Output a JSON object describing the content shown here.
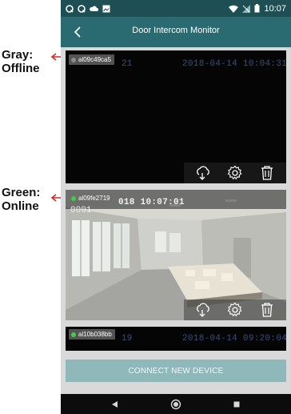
{
  "status_bar": {
    "time": "10:07",
    "icons": [
      "notification-icon",
      "notification-icon",
      "cloud-icon",
      "image-icon",
      "wifi-icon",
      "signal-icon",
      "battery-icon"
    ]
  },
  "app_bar": {
    "title": "Door Intercom Monitor"
  },
  "annotations": {
    "gray": {
      "line1": "Gray:",
      "line2": "Offline"
    },
    "green": {
      "line1": "Green:",
      "line2": "Online"
    },
    "arrow_color": "#d12a2a"
  },
  "devices": [
    {
      "id": "al09c49ca5",
      "status": "offline",
      "status_color": "#8a8a8a",
      "osd_time": "2018-04-14 10:04:31",
      "osd_num": "21"
    },
    {
      "id": "al09fe2719",
      "status": "online",
      "status_color": "#3fcf3f",
      "osd_time": "018 10:07:01",
      "osd_num": "0001"
    },
    {
      "id": "al10b038bb",
      "status": "online",
      "status_color": "#3fcf3f",
      "osd_time": "2018-04-14 09:20:04",
      "osd_num": "19"
    }
  ],
  "toolbar_icons": [
    "cloud-playback-icon",
    "settings-icon",
    "delete-icon"
  ],
  "connect_button": {
    "label": "CONNECT NEW DEVICE"
  },
  "nav": [
    "back-triangle-icon",
    "home-circle-icon",
    "recents-square-icon"
  ],
  "colors": {
    "status_bar": "#1d4f55",
    "app_bar": "#2a6b72",
    "button": "#8fb8bb"
  }
}
